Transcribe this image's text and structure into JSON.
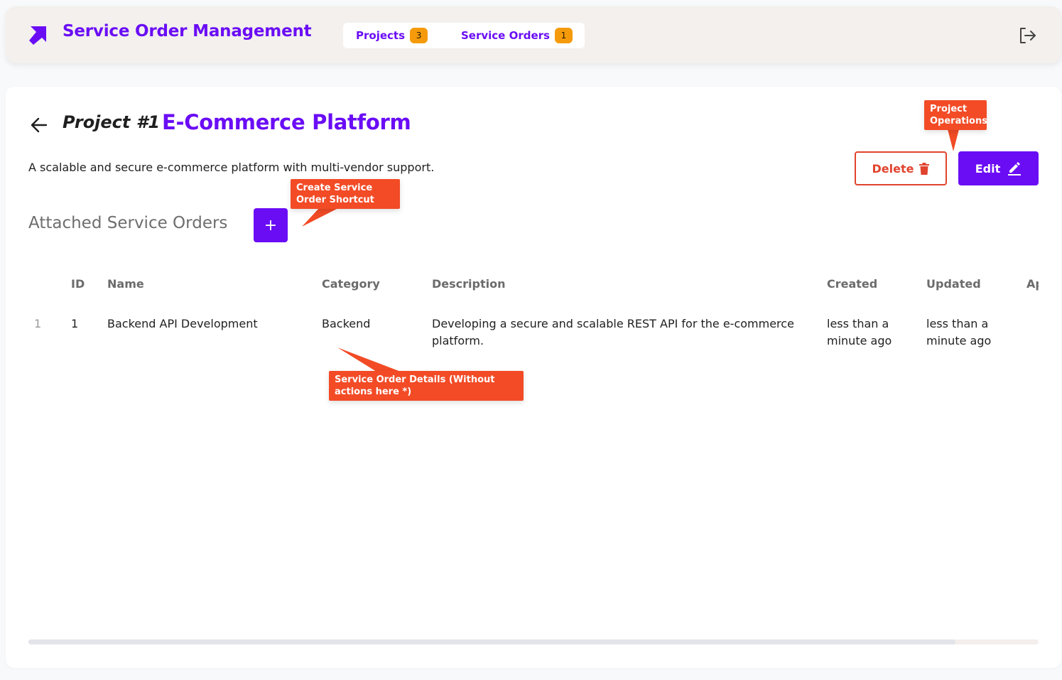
{
  "header": {
    "title": "Service Order Management",
    "nav": [
      {
        "label": "Projects",
        "count": "3"
      },
      {
        "label": "Service Orders",
        "count": "1"
      }
    ]
  },
  "project": {
    "label": "Project #1",
    "name": "E-Commerce Platform",
    "description": "A scalable and secure e-commerce platform with multi-vendor support."
  },
  "actions": {
    "delete_label": "Delete",
    "edit_label": "Edit"
  },
  "section": {
    "title": "Attached Service Orders",
    "add_label": "+"
  },
  "table": {
    "columns": [
      "ID",
      "Name",
      "Category",
      "Description",
      "Created",
      "Updated",
      "Ap"
    ],
    "rows": [
      {
        "index": "1",
        "id": "1",
        "name": "Backend API Development",
        "category": "Backend",
        "description": "Developing a secure and scalable REST API for the e-commerce platform.",
        "created": "less than a minute ago",
        "updated": "less than a minute ago"
      }
    ]
  },
  "annotations": {
    "project_operations": "Project Operations",
    "create_shortcut": "Create Service Order Shortcut",
    "order_details": "Service Order Details (Without actions here *)"
  },
  "colors": {
    "accent": "#6a0df5",
    "danger": "#e0432e",
    "badge": "#f59b0b",
    "callout": "#f24b26"
  }
}
